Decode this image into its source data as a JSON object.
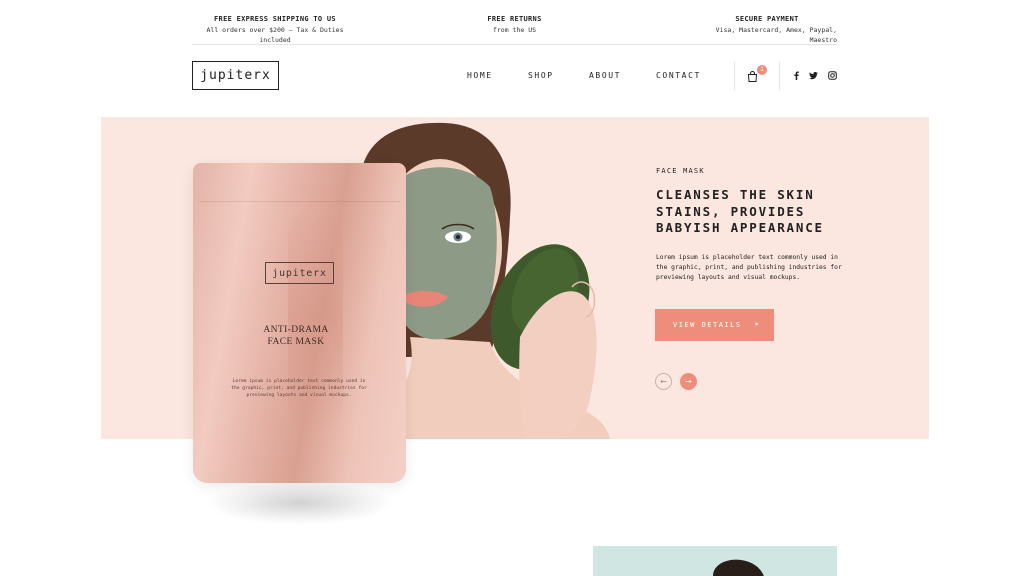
{
  "topbar": {
    "shipping": {
      "title": "FREE EXPRESS SHIPPING TO US",
      "subtitle": "All orders over $200 — Tax & Duties included"
    },
    "returns": {
      "title": "FREE RETURNS",
      "subtitle": "from the US"
    },
    "payment": {
      "title": "SECURE PAYMENT",
      "subtitle": "Visa, Mastercard, Amex, Paypal, Maestro"
    }
  },
  "header": {
    "logo": "jupiterx",
    "nav": [
      "HOME",
      "SHOP",
      "ABOUT",
      "CONTACT"
    ],
    "cart_count": "1",
    "social": [
      "facebook-icon",
      "twitter-icon",
      "instagram-icon"
    ]
  },
  "hero": {
    "eyebrow": "FACE MASK",
    "headline": "CLEANSES THE SKIN STAINS, PROVIDES BABYISH APPEARANCE",
    "body": "Lorem ipsum is placeholder text commonly used in the graphic, print, and publishing industries for previewing layouts and visual mockups.",
    "cta_label": "VIEW DETAILS",
    "cta_arrow": "▸",
    "prev_arrow": "←",
    "next_arrow": "→",
    "accent": "#ef8d7c",
    "background": "#fbe6e0"
  },
  "product": {
    "logo": "jupiterx",
    "name_line1": "ANTI-DRAMA",
    "name_line2": "FACE MASK",
    "description": "Lorem ipsum is placeholder text commonly used in the graphic, print, and publishing industries for previewing layouts and visual mockups."
  }
}
